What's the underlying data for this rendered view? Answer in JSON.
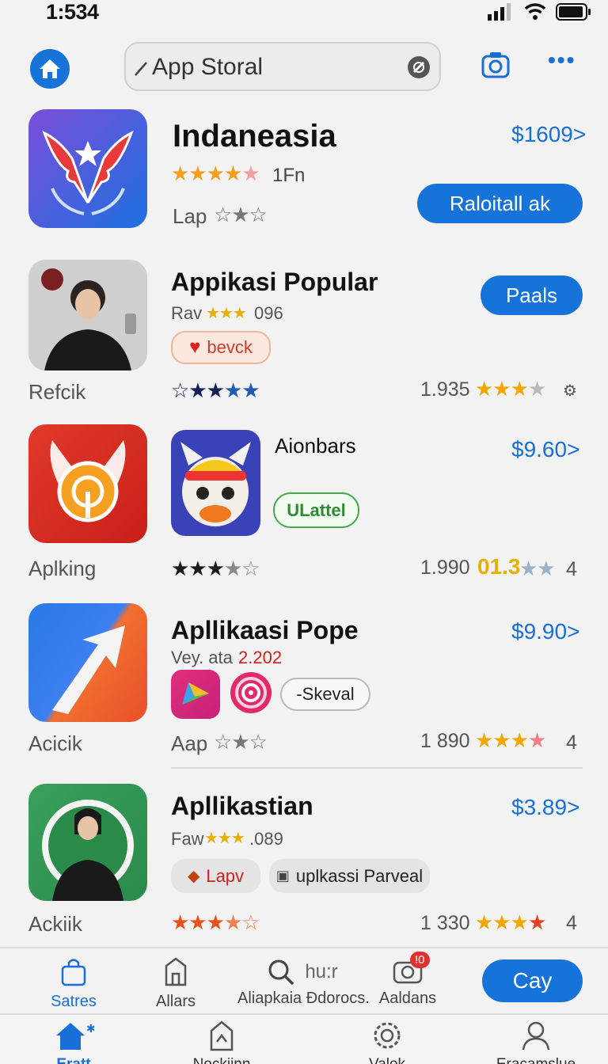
{
  "status_bar": {
    "time": "1:534"
  },
  "search": {
    "text": "App Storal"
  },
  "apps": [
    {
      "title": "Indaneasia",
      "price": "$1609>",
      "rating_text": "1Fn",
      "sub_label": "Lap",
      "action": "Raloitall ak"
    },
    {
      "title": "Appikasi Popular",
      "price_button": "Paals",
      "meta": "Rav",
      "meta_num": "096",
      "chip": "bevck",
      "left_label": "Refcik",
      "count": "1.935"
    },
    {
      "title": "Aionbars",
      "price": "$9.60>",
      "chip": "ULattel",
      "left_label": "Aplking",
      "count": "1.990",
      "rating_value": "01.3",
      "rating_end": "4"
    },
    {
      "title": "Apllikaasi Pope",
      "price": "$9.90>",
      "meta": "Vey. ata",
      "meta_num": "2.202",
      "chip": "-Skeval",
      "left_label": "Acicik",
      "sub_label": "Aap",
      "count": "1 890",
      "rating_end": "4"
    },
    {
      "title": "Apllikastian",
      "price": "$3.89>",
      "meta": "Faw",
      "meta_num": ".089",
      "chip1": "Lapv",
      "chip2": "uplkassi Parveal",
      "left_label": "Ackiik",
      "count": "1 330",
      "rating_end": "4"
    }
  ],
  "tabs": [
    {
      "label": "Satres"
    },
    {
      "label": "Allars"
    },
    {
      "label": "Aliapkaia Ðdorocs.",
      "search_hint": "hu:r"
    },
    {
      "label": "Aaldans",
      "badge": "!0"
    }
  ],
  "tab_action": "Cay",
  "bottom_nav": [
    {
      "label": "Eratt"
    },
    {
      "label": "Nockiinn"
    },
    {
      "label": "Valok"
    },
    {
      "label": "Eracamslue"
    }
  ],
  "colors": {
    "accent": "#1673d9",
    "star_gold": "#f0b400",
    "link_blue": "#1a6fd6"
  }
}
